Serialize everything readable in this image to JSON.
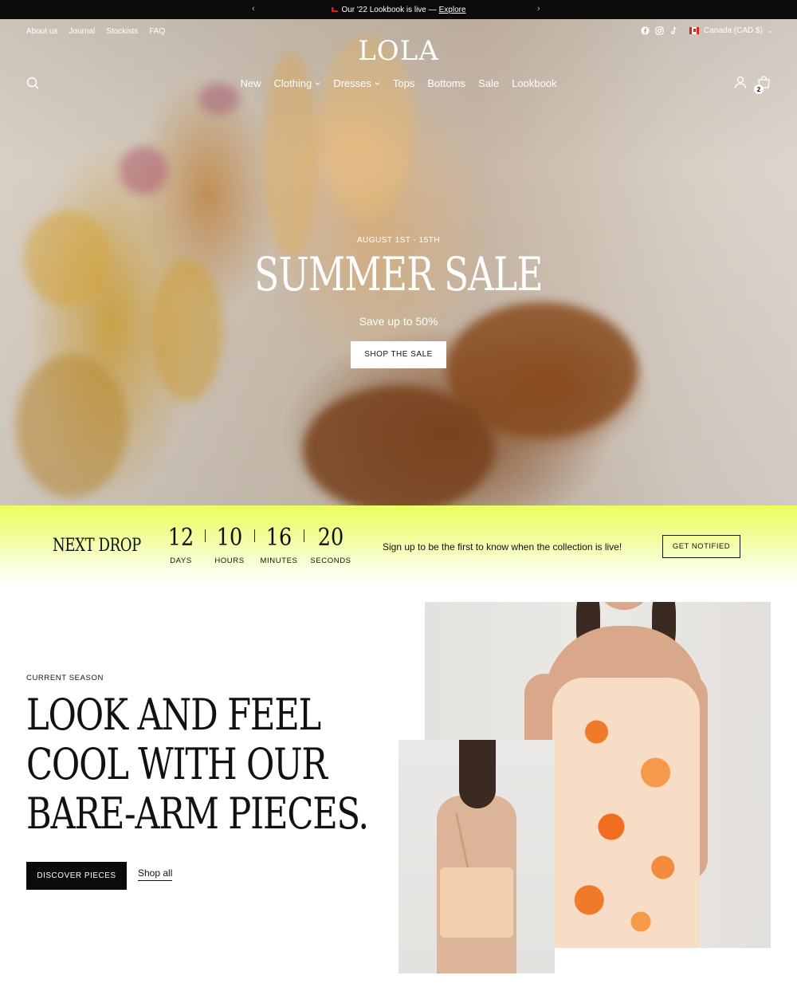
{
  "announcement": {
    "prefix": "Our '22 Lookbook is live — ",
    "link": "Explore",
    "prev_icon": "chevron-left-icon",
    "next_icon": "chevron-right-icon",
    "shoe_color": "#d42020"
  },
  "header": {
    "logo": "LOLA",
    "top_links": [
      "About us",
      "Journal",
      "Stockists",
      "FAQ"
    ],
    "social_icons": [
      "facebook-icon",
      "instagram-icon",
      "tiktok-icon"
    ],
    "locale": "Canada (CAD $)",
    "nav": [
      {
        "label": "New",
        "dropdown": false
      },
      {
        "label": "Clothing",
        "dropdown": true
      },
      {
        "label": "Dresses",
        "dropdown": true
      },
      {
        "label": "Tops",
        "dropdown": false
      },
      {
        "label": "Bottoms",
        "dropdown": false
      },
      {
        "label": "Sale",
        "dropdown": false
      },
      {
        "label": "Lookbook",
        "dropdown": false
      }
    ],
    "cart_count": "2"
  },
  "hero": {
    "date": "AUGUST 1ST - 15TH",
    "title": "SUMMER SALE",
    "subtitle": "Save up to 50%",
    "button": "SHOP THE SALE"
  },
  "drop": {
    "title": "NEXT DROP",
    "countdown": [
      {
        "value": "12",
        "label": "DAYS"
      },
      {
        "value": "10",
        "label": "HOURS"
      },
      {
        "value": "16",
        "label": "MINUTES"
      },
      {
        "value": "20",
        "label": "SECONDS"
      }
    ],
    "text": "Sign up to be the first to know when the collection is live!",
    "button": "GET NOTIFIED",
    "gradient_color": "#eafe5e"
  },
  "season": {
    "eyebrow": "CURRENT SEASON",
    "headline_lines": [
      "LOOK AND FEEL",
      "COOL WITH OUR",
      "BARE-ARM PIECES."
    ],
    "primary_button": "DISCOVER PIECES",
    "secondary_link": "Shop all"
  }
}
